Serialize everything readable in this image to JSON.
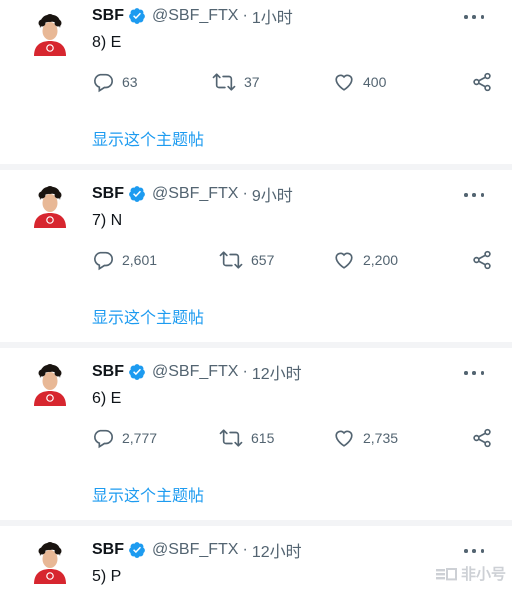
{
  "tweets": [
    {
      "name": "SBF",
      "handle": "@SBF_FTX",
      "separator": "·",
      "time": "1小时",
      "text": "8) E",
      "reply_count": "63",
      "retweet_count": "37",
      "like_count": "400",
      "show_thread_label": "显示这个主题帖"
    },
    {
      "name": "SBF",
      "handle": "@SBF_FTX",
      "separator": "·",
      "time": "9小时",
      "text": "7) N",
      "reply_count": "2,601",
      "retweet_count": "657",
      "like_count": "2,200",
      "show_thread_label": "显示这个主题帖"
    },
    {
      "name": "SBF",
      "handle": "@SBF_FTX",
      "separator": "·",
      "time": "12小时",
      "text": "6) E",
      "reply_count": "2,777",
      "retweet_count": "615",
      "like_count": "2,735",
      "show_thread_label": "显示这个主题帖"
    },
    {
      "name": "SBF",
      "handle": "@SBF_FTX",
      "separator": "·",
      "time": "12小时",
      "text": "5) P"
    }
  ],
  "watermark": {
    "text": "非小号"
  },
  "icons": {
    "reply": "reply-icon",
    "retweet": "retweet-icon",
    "like": "heart-icon",
    "share": "share-icon",
    "more": "more-icon",
    "verified": "verified-badge-icon"
  },
  "colors": {
    "accent": "#1d9bf0",
    "muted": "#536471",
    "text": "#0f1419",
    "divider": "#f3f4f6",
    "avatar_shirt": "#d7262f"
  }
}
